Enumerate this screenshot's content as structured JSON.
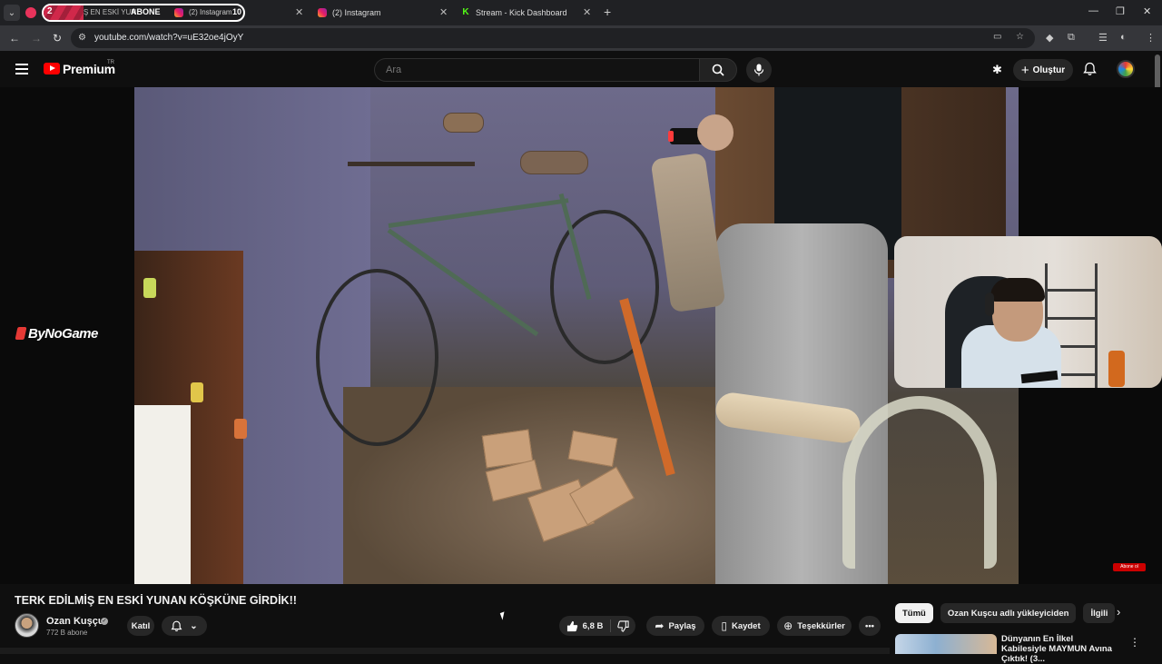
{
  "browser": {
    "tabs": [
      {
        "badge": "2",
        "text_partial": "Ş EN ESKİ YUN",
        "overlay_label": "ABONE",
        "tab_title": "(2) Instagram",
        "overlay_count": "10"
      },
      {
        "title": "(2) Instagram"
      },
      {
        "title": "Stream - Kick Dashboard"
      }
    ],
    "url": "youtube.com/watch?v=uE32oe4jOyY"
  },
  "youtube": {
    "brand": "Premium",
    "region": "TR",
    "search_placeholder": "Ara",
    "create_label": "Oluştur"
  },
  "overlays": {
    "sponsor_logo": "ByNoGame",
    "subscribe_badge": "Abone ol"
  },
  "video": {
    "title": "TERK EDİLMİŞ EN ESKİ YUNAN KÖŞKÜNE GİRDİK!!",
    "channel_name": "Ozan Kuşçu",
    "subscribers": "772 B abone",
    "join_label": "Katıl",
    "likes": "6,8 B",
    "share_label": "Paylaş",
    "save_label": "Kaydet",
    "thanks_label": "Teşekkürler"
  },
  "sidebar": {
    "chips": [
      "Tümü",
      "Ozan Kuşcu adlı yükleyiciden",
      "İlgili"
    ],
    "recommendation_title": "Dünyanın En İlkel Kabilesiyle MAYMUN Avına Çıktık! (3..."
  },
  "icons": {
    "hamburger": "menu-icon",
    "search": "search-icon",
    "mic": "mic-icon",
    "bell": "bell-icon",
    "like": "thumb-up-icon",
    "dislike": "thumb-down-icon"
  },
  "colors": {
    "background": "#0f0f0f",
    "pill": "#272727",
    "brand_red": "#ff0000",
    "text": "#f1f1f1"
  }
}
